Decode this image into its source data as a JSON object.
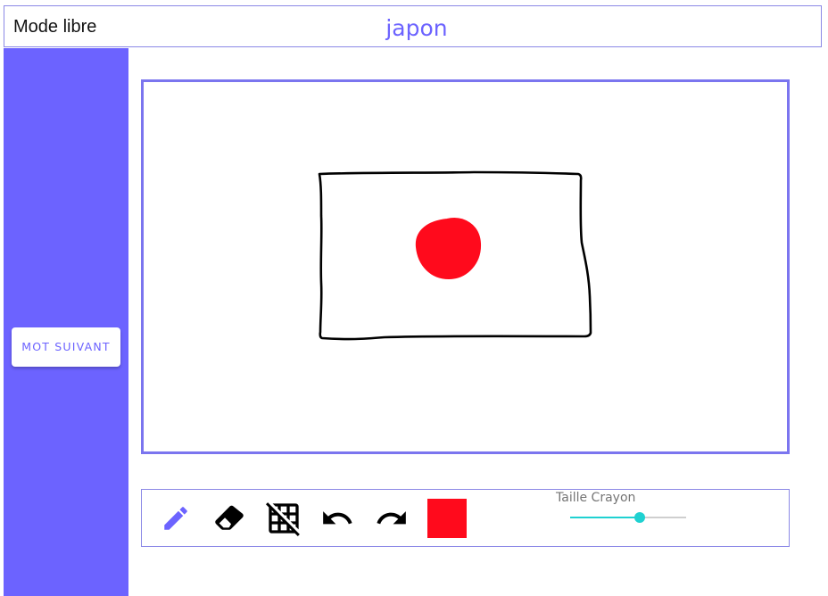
{
  "header": {
    "mode_title": "Mode libre",
    "word": "japon"
  },
  "sidebar": {
    "next_word_label": "MOT SUIVANT"
  },
  "toolbar": {
    "tools": [
      {
        "name": "pencil-icon",
        "active": true
      },
      {
        "name": "eraser-icon",
        "active": false
      },
      {
        "name": "grid-off-icon",
        "active": false
      },
      {
        "name": "undo-icon",
        "active": false
      },
      {
        "name": "redo-icon",
        "active": false
      }
    ],
    "current_color": "#ff0a1c",
    "pen_size_label": "Taille Crayon",
    "pen_size_value": 0.6
  },
  "colors": {
    "accent": "#6c63ff",
    "slider": "#1fd1d1",
    "ink": "#000000"
  }
}
